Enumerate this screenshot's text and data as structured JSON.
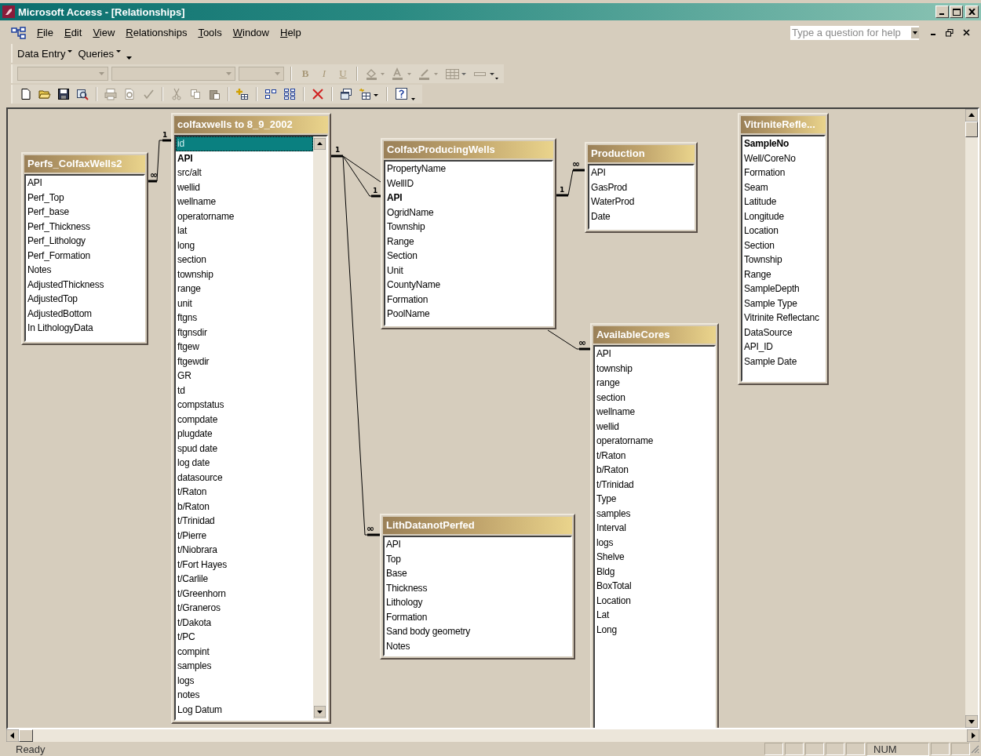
{
  "window": {
    "title": "Microsoft Access - [Relationships]"
  },
  "menu": [
    "File",
    "Edit",
    "View",
    "Relationships",
    "Tools",
    "Window",
    "Help"
  ],
  "help_box": {
    "placeholder": "Type a question for help"
  },
  "toolbar_menus": [
    "Data Entry",
    "Queries"
  ],
  "format_buttons": [
    "B",
    "I",
    "U"
  ],
  "tables": [
    {
      "title": "Perfs_ColfaxWells2",
      "scrollbar": false,
      "fields": [
        {
          "name": "API",
          "key": false,
          "selected": false
        },
        {
          "name": "Perf_Top",
          "key": false,
          "selected": false
        },
        {
          "name": "Perf_base",
          "key": false,
          "selected": false
        },
        {
          "name": "Perf_Thickness",
          "key": false,
          "selected": false
        },
        {
          "name": "Perf_Lithology",
          "key": false,
          "selected": false
        },
        {
          "name": "Perf_Formation",
          "key": false,
          "selected": false
        },
        {
          "name": "Notes",
          "key": false,
          "selected": false
        },
        {
          "name": "AdjustedThickness",
          "key": false,
          "selected": false
        },
        {
          "name": "AdjustedTop",
          "key": false,
          "selected": false
        },
        {
          "name": "AdjustedBottom",
          "key": false,
          "selected": false
        },
        {
          "name": "In LithologyData",
          "key": false,
          "selected": false
        }
      ]
    },
    {
      "title": "colfaxwells to 8_9_2002",
      "scrollbar": true,
      "fields": [
        {
          "name": "id",
          "key": false,
          "selected": true
        },
        {
          "name": "API",
          "key": true,
          "selected": false
        },
        {
          "name": "src/alt",
          "key": false,
          "selected": false
        },
        {
          "name": "wellid",
          "key": false,
          "selected": false
        },
        {
          "name": "wellname",
          "key": false,
          "selected": false
        },
        {
          "name": "operatorname",
          "key": false,
          "selected": false
        },
        {
          "name": "lat",
          "key": false,
          "selected": false
        },
        {
          "name": "long",
          "key": false,
          "selected": false
        },
        {
          "name": "section",
          "key": false,
          "selected": false
        },
        {
          "name": "township",
          "key": false,
          "selected": false
        },
        {
          "name": "range",
          "key": false,
          "selected": false
        },
        {
          "name": "unit",
          "key": false,
          "selected": false
        },
        {
          "name": "ftgns",
          "key": false,
          "selected": false
        },
        {
          "name": "ftgnsdir",
          "key": false,
          "selected": false
        },
        {
          "name": "ftgew",
          "key": false,
          "selected": false
        },
        {
          "name": "ftgewdir",
          "key": false,
          "selected": false
        },
        {
          "name": "GR",
          "key": false,
          "selected": false
        },
        {
          "name": "td",
          "key": false,
          "selected": false
        },
        {
          "name": "compstatus",
          "key": false,
          "selected": false
        },
        {
          "name": "compdate",
          "key": false,
          "selected": false
        },
        {
          "name": "plugdate",
          "key": false,
          "selected": false
        },
        {
          "name": "spud date",
          "key": false,
          "selected": false
        },
        {
          "name": "log date",
          "key": false,
          "selected": false
        },
        {
          "name": "datasource",
          "key": false,
          "selected": false
        },
        {
          "name": "t/Raton",
          "key": false,
          "selected": false
        },
        {
          "name": "b/Raton",
          "key": false,
          "selected": false
        },
        {
          "name": "t/Trinidad",
          "key": false,
          "selected": false
        },
        {
          "name": "t/Pierre",
          "key": false,
          "selected": false
        },
        {
          "name": "t/Niobrara",
          "key": false,
          "selected": false
        },
        {
          "name": "t/Fort Hayes",
          "key": false,
          "selected": false
        },
        {
          "name": "t/Carlile",
          "key": false,
          "selected": false
        },
        {
          "name": "t/Greenhorn",
          "key": false,
          "selected": false
        },
        {
          "name": "t/Graneros",
          "key": false,
          "selected": false
        },
        {
          "name": "t/Dakota",
          "key": false,
          "selected": false
        },
        {
          "name": "t/PC",
          "key": false,
          "selected": false
        },
        {
          "name": "compint",
          "key": false,
          "selected": false
        },
        {
          "name": "samples",
          "key": false,
          "selected": false
        },
        {
          "name": "logs",
          "key": false,
          "selected": false
        },
        {
          "name": "notes",
          "key": false,
          "selected": false
        },
        {
          "name": "Log Datum",
          "key": false,
          "selected": false
        }
      ]
    },
    {
      "title": "ColfaxProducingWells",
      "scrollbar": false,
      "fields": [
        {
          "name": "PropertyName",
          "key": false,
          "selected": false
        },
        {
          "name": "WellID",
          "key": false,
          "selected": false
        },
        {
          "name": "API",
          "key": true,
          "selected": false
        },
        {
          "name": "OgridName",
          "key": false,
          "selected": false
        },
        {
          "name": "Township",
          "key": false,
          "selected": false
        },
        {
          "name": "Range",
          "key": false,
          "selected": false
        },
        {
          "name": "Section",
          "key": false,
          "selected": false
        },
        {
          "name": "Unit",
          "key": false,
          "selected": false
        },
        {
          "name": "CountyName",
          "key": false,
          "selected": false
        },
        {
          "name": "Formation",
          "key": false,
          "selected": false
        },
        {
          "name": "PoolName",
          "key": false,
          "selected": false
        }
      ]
    },
    {
      "title": "Production",
      "scrollbar": false,
      "fields": [
        {
          "name": "API",
          "key": false,
          "selected": false
        },
        {
          "name": "GasProd",
          "key": false,
          "selected": false
        },
        {
          "name": "WaterProd",
          "key": false,
          "selected": false
        },
        {
          "name": "Date",
          "key": false,
          "selected": false
        }
      ]
    },
    {
      "title": "VitriniteRefle...",
      "scrollbar": false,
      "fields": [
        {
          "name": "SampleNo",
          "key": true,
          "selected": false
        },
        {
          "name": "Well/CoreNo",
          "key": false,
          "selected": false
        },
        {
          "name": "Formation",
          "key": false,
          "selected": false
        },
        {
          "name": "Seam",
          "key": false,
          "selected": false
        },
        {
          "name": "Latitude",
          "key": false,
          "selected": false
        },
        {
          "name": "Longitude",
          "key": false,
          "selected": false
        },
        {
          "name": "Location",
          "key": false,
          "selected": false
        },
        {
          "name": "Section",
          "key": false,
          "selected": false
        },
        {
          "name": "Township",
          "key": false,
          "selected": false
        },
        {
          "name": "Range",
          "key": false,
          "selected": false
        },
        {
          "name": "SampleDepth",
          "key": false,
          "selected": false
        },
        {
          "name": "Sample Type",
          "key": false,
          "selected": false
        },
        {
          "name": "Vitrinite Reflectanc",
          "key": false,
          "selected": false
        },
        {
          "name": "DataSource",
          "key": false,
          "selected": false
        },
        {
          "name": "API_ID",
          "key": false,
          "selected": false
        },
        {
          "name": "Sample Date",
          "key": false,
          "selected": false
        }
      ]
    },
    {
      "title": "AvailableCores",
      "scrollbar": false,
      "fields": [
        {
          "name": "API",
          "key": false,
          "selected": false
        },
        {
          "name": "township",
          "key": false,
          "selected": false
        },
        {
          "name": "range",
          "key": false,
          "selected": false
        },
        {
          "name": "section",
          "key": false,
          "selected": false
        },
        {
          "name": "wellname",
          "key": false,
          "selected": false
        },
        {
          "name": "wellid",
          "key": false,
          "selected": false
        },
        {
          "name": "operatorname",
          "key": false,
          "selected": false
        },
        {
          "name": "t/Raton",
          "key": false,
          "selected": false
        },
        {
          "name": "b/Raton",
          "key": false,
          "selected": false
        },
        {
          "name": "t/Trinidad",
          "key": false,
          "selected": false
        },
        {
          "name": "Type",
          "key": false,
          "selected": false
        },
        {
          "name": "samples",
          "key": false,
          "selected": false
        },
        {
          "name": "Interval",
          "key": false,
          "selected": false
        },
        {
          "name": "logs",
          "key": false,
          "selected": false
        },
        {
          "name": "Shelve",
          "key": false,
          "selected": false
        },
        {
          "name": "Bldg",
          "key": false,
          "selected": false
        },
        {
          "name": "BoxTotal",
          "key": false,
          "selected": false
        },
        {
          "name": "Location",
          "key": false,
          "selected": false
        },
        {
          "name": "Lat",
          "key": false,
          "selected": false
        },
        {
          "name": "Long",
          "key": false,
          "selected": false
        }
      ]
    },
    {
      "title": "LithDatanotPerfed",
      "scrollbar": false,
      "fields": [
        {
          "name": "API",
          "key": false,
          "selected": false
        },
        {
          "name": "Top",
          "key": false,
          "selected": false
        },
        {
          "name": "Base",
          "key": false,
          "selected": false
        },
        {
          "name": "Thickness",
          "key": false,
          "selected": false
        },
        {
          "name": "Lithology",
          "key": false,
          "selected": false
        },
        {
          "name": "Formation",
          "key": false,
          "selected": false
        },
        {
          "name": "Sand body geometry",
          "key": false,
          "selected": false
        },
        {
          "name": "Notes",
          "key": false,
          "selected": false
        }
      ]
    }
  ],
  "relationships": [
    {
      "ends": [
        "1",
        "∞"
      ]
    },
    {
      "ends": [
        "1",
        "1"
      ]
    },
    {
      "ends": [
        "∞"
      ]
    },
    {
      "ends": [
        "1",
        "∞"
      ]
    },
    {
      "ends": [
        "∞"
      ]
    }
  ],
  "status_bar": {
    "text": "Ready",
    "indicators": [
      "NUM"
    ]
  }
}
